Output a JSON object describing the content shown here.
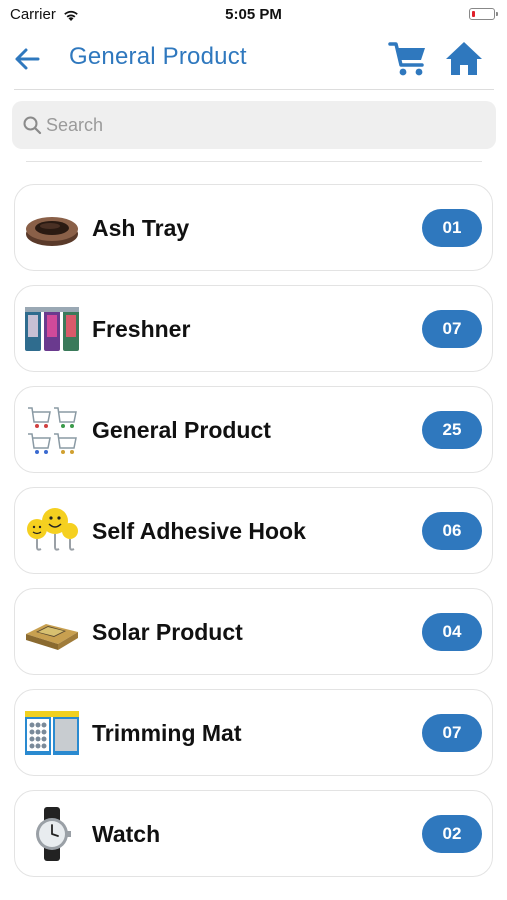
{
  "status_bar": {
    "carrier": "Carrier",
    "time": "5:05 PM",
    "icons": [
      "wifi-icon",
      "battery-icon"
    ]
  },
  "header": {
    "title": "General Product",
    "back_icon": "arrow-left-icon",
    "cart_icon": "shopping-cart-icon",
    "home_icon": "home-icon"
  },
  "search": {
    "placeholder": "Search",
    "value": ""
  },
  "colors": {
    "accent": "#2f78be",
    "text": "#111111",
    "search_bg": "#efefef"
  },
  "categories": [
    {
      "label": "Ash Tray",
      "count": "01",
      "thumb": "ash-tray-thumbnail"
    },
    {
      "label": "Freshner",
      "count": "07",
      "thumb": "freshner-thumbnail"
    },
    {
      "label": "General Product",
      "count": "25",
      "thumb": "general-product-thumbnail"
    },
    {
      "label": "Self Adhesive Hook",
      "count": "06",
      "thumb": "self-adhesive-hook-thumbnail"
    },
    {
      "label": "Solar Product",
      "count": "04",
      "thumb": "solar-product-thumbnail"
    },
    {
      "label": "Trimming Mat",
      "count": "07",
      "thumb": "trimming-mat-thumbnail"
    },
    {
      "label": "Watch",
      "count": "02",
      "thumb": "watch-thumbnail"
    }
  ]
}
